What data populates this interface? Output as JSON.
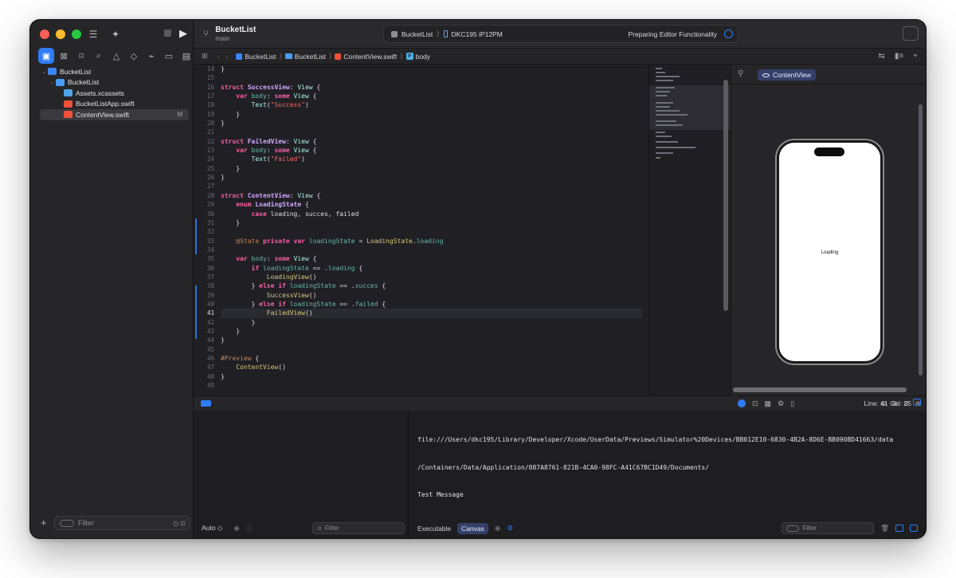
{
  "sidebar": {
    "tree": [
      {
        "label": "BucketList",
        "level": 0,
        "icon": "project-icon"
      },
      {
        "label": "BucketList",
        "level": 1,
        "icon": "folder-icon"
      },
      {
        "label": "Assets.xcassets",
        "level": 2,
        "icon": "assets-icon"
      },
      {
        "label": "BucketListApp.swift",
        "level": 2,
        "icon": "swift-file-icon"
      },
      {
        "label": "ContentView.swift",
        "level": 2,
        "icon": "swift-file-icon",
        "selected": true,
        "badge": "M"
      }
    ],
    "filter_placeholder": "Filter"
  },
  "toolbar": {
    "project_title": "BucketList",
    "branch": "main",
    "scheme": "BucketList",
    "device": "DKC195 iP12PM",
    "status": "Preparing Editor Functionality"
  },
  "jumpbar": {
    "crumbs": [
      "BucketList",
      "BucketList",
      "ContentView.swift",
      "body"
    ]
  },
  "editor": {
    "first_line": 14,
    "current_line": 41,
    "lines": [
      "}",
      "",
      "struct SuccessView: View {",
      "    var body: some View {",
      "        Text(\"Success\")",
      "    }",
      "}",
      "",
      "struct FailedView: View {",
      "    var body: some View {",
      "        Text(\"Failed\")",
      "    }",
      "}",
      "",
      "struct ContentView: View {",
      "    enum LoadingState {",
      "        case loading, succes, failed",
      "    }",
      "",
      "    @State private var loadingState = LoadingState.loading",
      "",
      "    var body: some View {",
      "        if loadingState == .loading {",
      "            LoadingView()",
      "        } else if loadingState == .succes {",
      "            SuccessView()",
      "        } else if loadingState == .failed {",
      "            FailedView()",
      "        }",
      "    }",
      "}",
      "",
      "#Preview {",
      "    ContentView()",
      "}",
      ""
    ]
  },
  "canvas": {
    "tab_label": "ContentView",
    "preview_text": "Loading"
  },
  "debug": {
    "line_col": "Line: 41  Col: 25",
    "auto_label": "Auto ◇",
    "vars_filter_placeholder": "Filter",
    "console_lines": [
      "file:///Users/dkc195/Library/Developer/Xcode/UserData/Previews/Simulator%20Devices/BB012E10-6830-4B2A-8D6E-BB090BD41663/data",
      "/Containers/Data/Application/087A8761-821B-4CA0-98FC-A41C67BC1D49/Documents/",
      "Test Message"
    ],
    "executable_label": "Executable",
    "canvas_label": "Canvas",
    "console_filter_placeholder": "Filter"
  },
  "colors": {
    "accent": "#2f7cf6",
    "keyword": "#fc5fa3",
    "type_decl": "#d0a8ff",
    "string": "#fc6a5d"
  }
}
